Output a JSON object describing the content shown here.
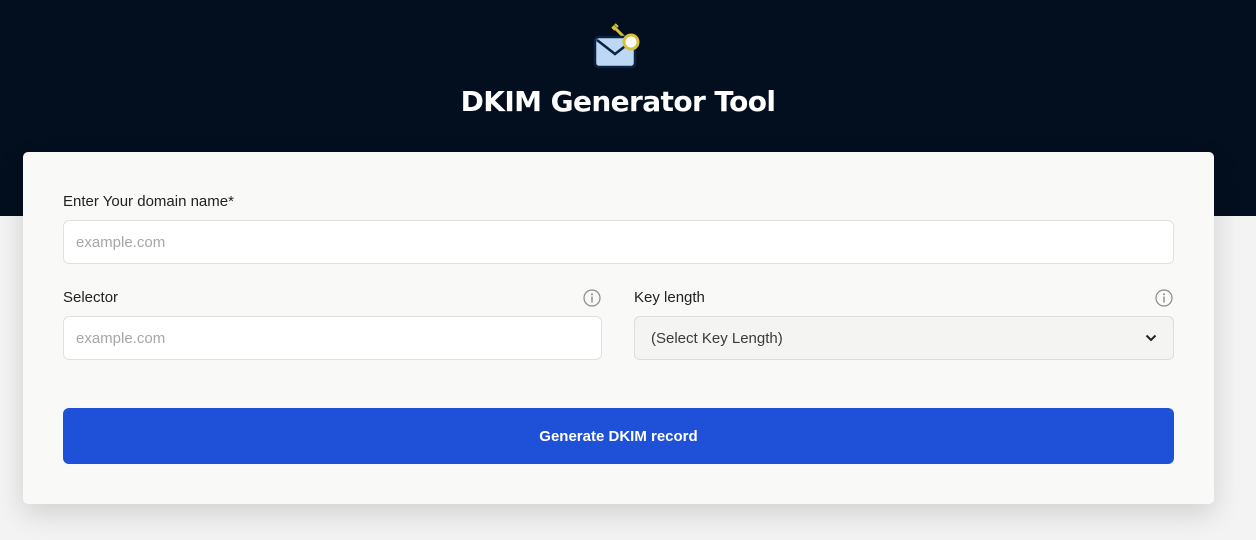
{
  "header": {
    "title": "DKIM Generator Tool",
    "logo_icon": "envelope-key-icon",
    "background": "#030f1e"
  },
  "form": {
    "domain": {
      "label": "Enter Your domain name*",
      "placeholder": "example.com",
      "value": ""
    },
    "selector": {
      "label": "Selector",
      "placeholder": "example.com",
      "value": "",
      "info_icon": "info-icon"
    },
    "key_length": {
      "label": "Key length",
      "selected": "(Select Key Length)",
      "info_icon": "info-icon",
      "dropdown_icon": "chevron-down-icon"
    },
    "submit": {
      "label": "Generate DKIM record",
      "color": "#1e50d8"
    }
  }
}
